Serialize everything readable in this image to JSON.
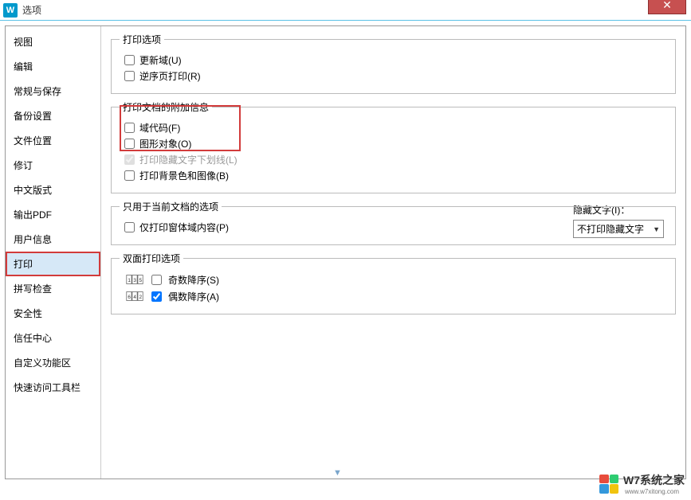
{
  "titlebar": {
    "title": "选项",
    "app_icon_text": "W"
  },
  "sidebar": {
    "items": [
      {
        "label": "视图"
      },
      {
        "label": "编辑"
      },
      {
        "label": "常规与保存"
      },
      {
        "label": "备份设置"
      },
      {
        "label": "文件位置"
      },
      {
        "label": "修订"
      },
      {
        "label": "中文版式"
      },
      {
        "label": "输出PDF"
      },
      {
        "label": "用户信息"
      },
      {
        "label": "打印"
      },
      {
        "label": "拼写检查"
      },
      {
        "label": "安全性"
      },
      {
        "label": "信任中心"
      },
      {
        "label": "自定义功能区"
      },
      {
        "label": "快速访问工具栏"
      }
    ],
    "selected_index": 9,
    "marked_index": 9
  },
  "main": {
    "group_print_options": {
      "legend": "打印选项",
      "opts": [
        {
          "label": "更新域(U)",
          "checked": false
        },
        {
          "label": "逆序页打印(R)",
          "checked": false
        }
      ]
    },
    "group_doc_info": {
      "legend": "打印文档的附加信息",
      "opts": [
        {
          "label": "域代码(F)",
          "checked": false
        },
        {
          "label": "图形对象(O)",
          "checked": false
        },
        {
          "label": "打印隐藏文字下划线(L)",
          "checked": true,
          "disabled": true
        },
        {
          "label": "打印背景色和图像(B)",
          "checked": false
        }
      ],
      "hidden_text": {
        "label": "隐藏文字(I)：",
        "value": "不打印隐藏文字"
      }
    },
    "group_current_doc": {
      "legend": "只用于当前文档的选项",
      "opts": [
        {
          "label": "仅打印窗体域内容(P)",
          "checked": false
        }
      ]
    },
    "group_duplex": {
      "legend": "双面打印选项",
      "opts": [
        {
          "label": "奇数降序(S)",
          "checked": false
        },
        {
          "label": "偶数降序(A)",
          "checked": true
        }
      ]
    }
  },
  "watermark": {
    "main": "W7系统之家",
    "sub": "www.w7xitong.com"
  }
}
